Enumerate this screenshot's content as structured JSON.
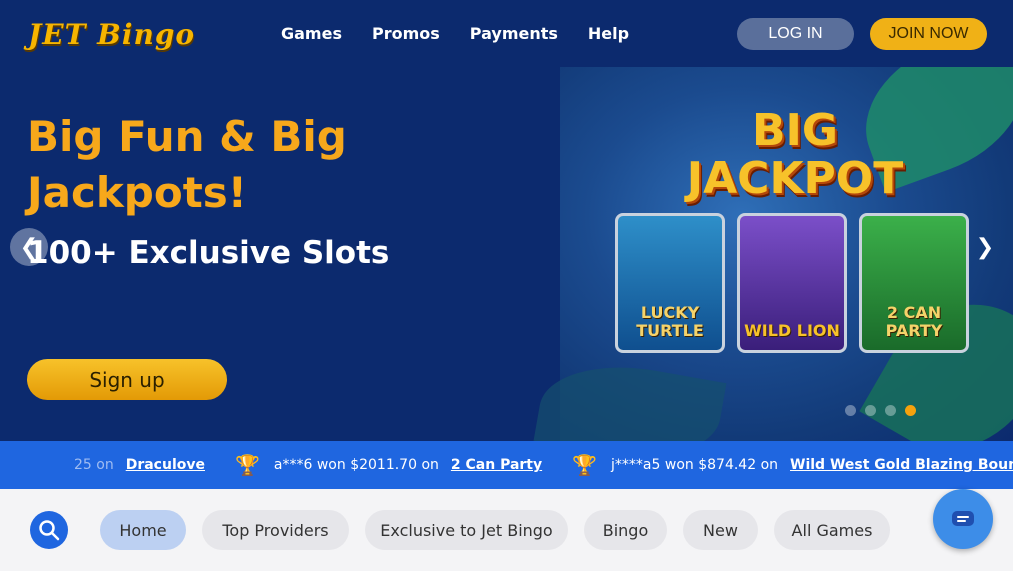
{
  "header": {
    "logo": "JET Bingo",
    "nav": [
      "Games",
      "Promos",
      "Payments",
      "Help"
    ],
    "login_label": "LOG IN",
    "join_label": "JOIN NOW"
  },
  "hero": {
    "title": "Big Fun & Big Jackpots!",
    "subtitle": "100+ Exclusive Slots",
    "signup_label": "Sign up",
    "banner_text": "BIG JACKPOT",
    "games": [
      "LUCKY TURTLE",
      "WILD LION",
      "2 CAN PARTY"
    ],
    "slide_count": 4,
    "active_slide": 4
  },
  "ticker": {
    "items": [
      {
        "prefix": "25 on",
        "game": "Draculove"
      },
      {
        "user": "a***6",
        "amount": "$2011.70",
        "game": "2 Can Party"
      },
      {
        "user": "j****a5",
        "amount": "$874.42",
        "game": "Wild West Gold Blazing Bounty"
      }
    ]
  },
  "categories": [
    "Home",
    "Top Providers",
    "Exclusive to Jet Bingo",
    "Bingo",
    "New",
    "All Games"
  ],
  "active_category": "Home",
  "colors": {
    "header_bg": "#0c2a6e",
    "accent": "#f7a81b",
    "ticker_bg": "#1f66e0"
  }
}
